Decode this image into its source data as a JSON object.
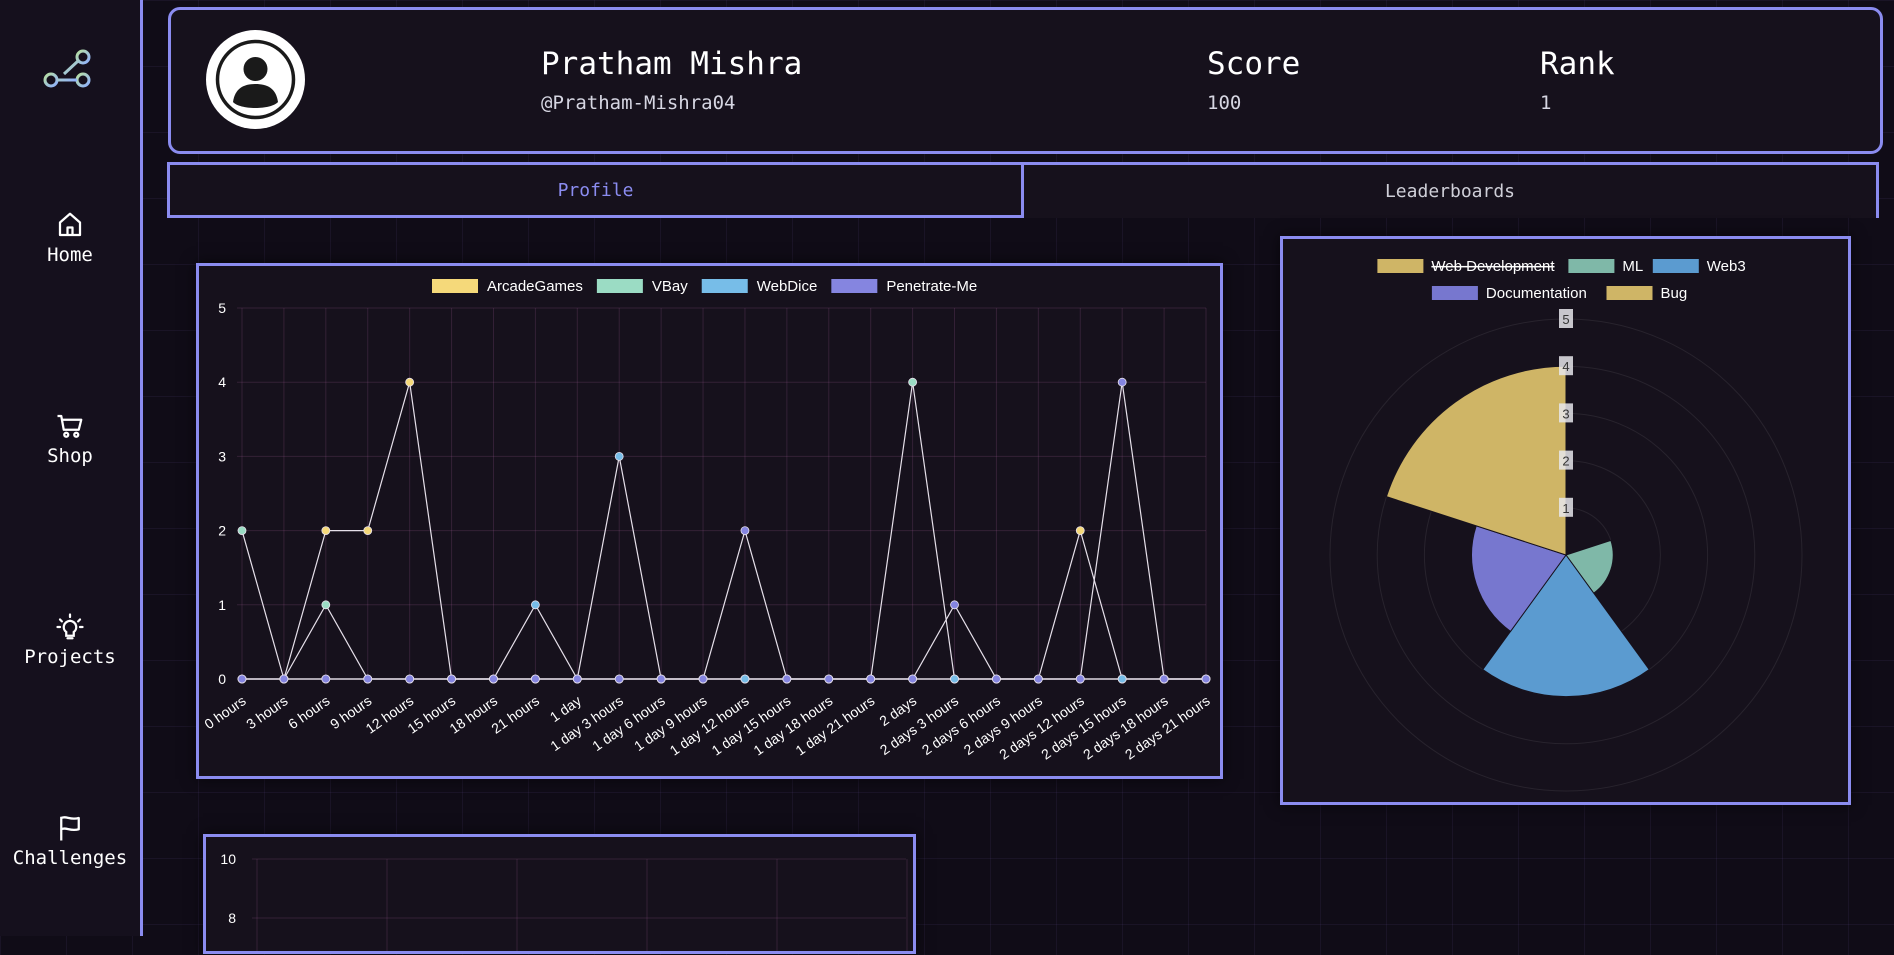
{
  "sidebar": {
    "items": [
      {
        "label": "Home",
        "icon": "home-icon"
      },
      {
        "label": "Shop",
        "icon": "cart-icon"
      },
      {
        "label": "Projects",
        "icon": "lightbulb-icon"
      },
      {
        "label": "Challenges",
        "icon": "flag-icon"
      }
    ]
  },
  "profile": {
    "name": "Pratham Mishra",
    "handle": "@Pratham-Mishra04",
    "score_label": "Score",
    "score_value": "100",
    "rank_label": "Rank",
    "rank_value": "1"
  },
  "tabs": [
    {
      "label": "Profile",
      "active": true
    },
    {
      "label": "Leaderboards",
      "active": false
    }
  ],
  "colors": {
    "accent": "#8b8cf0",
    "background": "#100c17",
    "panel": "#16111c"
  },
  "chart_data": [
    {
      "type": "line",
      "categories": [
        "0 hours",
        "3 hours",
        "6 hours",
        "9 hours",
        "12 hours",
        "15 hours",
        "18 hours",
        "21 hours",
        "1 day",
        "1 day 3 hours",
        "1 day 6 hours",
        "1 day 9 hours",
        "1 day 12 hours",
        "1 day 15 hours",
        "1 day 18 hours",
        "1 day 21 hours",
        "2 days",
        "2 days 3 hours",
        "2 days 6 hours",
        "2 days 9 hours",
        "2 days 12 hours",
        "2 days 15 hours",
        "2 days 18 hours",
        "2 days 21 hours"
      ],
      "ylim": [
        0,
        5
      ],
      "yticks": [
        "0",
        "1",
        "2",
        "3",
        "4",
        "5"
      ],
      "grid": true,
      "legend_position": "top",
      "series": [
        {
          "name": "ArcadeGames",
          "color": "#f5d97a",
          "values": [
            0,
            0,
            2,
            2,
            4,
            0,
            0,
            0,
            0,
            0,
            0,
            0,
            0,
            0,
            0,
            0,
            0,
            0,
            0,
            0,
            2,
            0,
            0,
            0
          ]
        },
        {
          "name": "VBay",
          "color": "#9bdcc4",
          "values": [
            2,
            0,
            1,
            0,
            0,
            0,
            0,
            0,
            0,
            0,
            0,
            0,
            0,
            0,
            0,
            0,
            4,
            0,
            0,
            0,
            0,
            0,
            0,
            0
          ]
        },
        {
          "name": "WebDice",
          "color": "#77bde8",
          "values": [
            0,
            0,
            0,
            0,
            0,
            0,
            0,
            1,
            0,
            3,
            0,
            0,
            0,
            0,
            0,
            0,
            0,
            0,
            0,
            0,
            0,
            0,
            0,
            0
          ]
        },
        {
          "name": "Penetrate-Me",
          "color": "#8585e0",
          "values": [
            0,
            0,
            0,
            0,
            0,
            0,
            0,
            0,
            0,
            0,
            0,
            0,
            2,
            0,
            0,
            0,
            0,
            1,
            0,
            0,
            0,
            4,
            0,
            0
          ]
        }
      ]
    },
    {
      "type": "polar-area",
      "legend_position": "top",
      "rlim": [
        0,
        5
      ],
      "rticks": [
        "1",
        "2",
        "3",
        "4",
        "5"
      ],
      "grid": true,
      "labels": [
        "Web Development",
        "ML",
        "Web3",
        "Documentation",
        "Bug"
      ],
      "hidden": [
        "Web Development"
      ],
      "values": [
        0,
        1,
        3,
        2,
        4
      ],
      "colors": [
        "#cfb566",
        "#7fb8a8",
        "#5b9bd0",
        "#7777cf",
        "#cfb566"
      ]
    },
    {
      "type": "line",
      "ylim": [
        0,
        10
      ],
      "yticks": [
        "8",
        "10"
      ],
      "grid": true
    }
  ]
}
